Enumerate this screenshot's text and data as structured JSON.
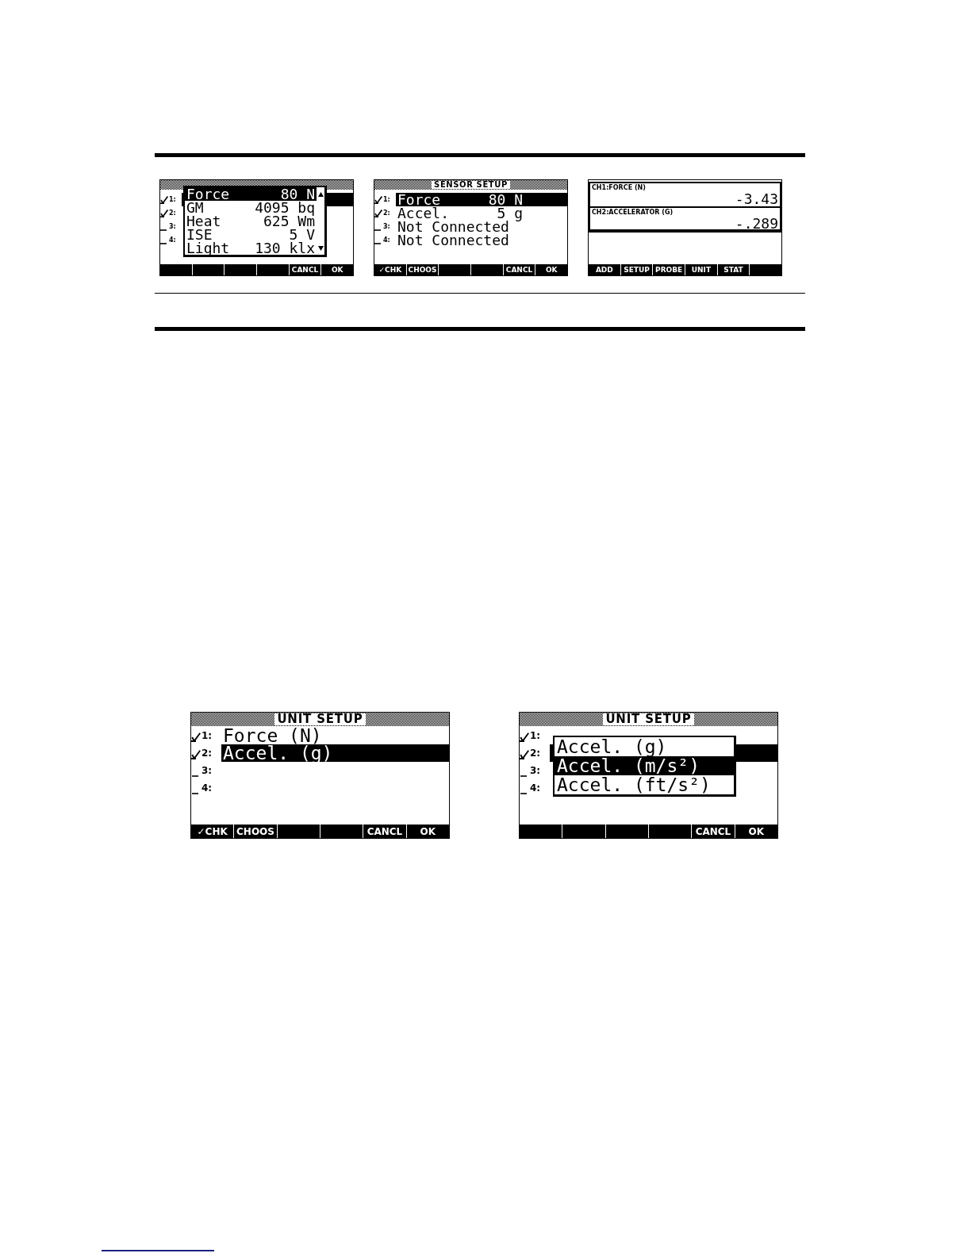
{
  "top_figure": {
    "screens": [
      {
        "kind": "setup",
        "rows": [
          {
            "checked": true,
            "number": "1:",
            "selected": true
          },
          {
            "checked": true,
            "number": "2:",
            "selected": false
          },
          {
            "checked": false,
            "number": "3:",
            "selected": false
          },
          {
            "checked": false,
            "number": "4:",
            "selected": false
          }
        ],
        "popup": {
          "scroll_indicators": true,
          "items": [
            {
              "name": "Force",
              "value": "80 N",
              "selected": true
            },
            {
              "name": "GM",
              "value": "4095 bq",
              "selected": false
            },
            {
              "name": "Heat",
              "value": "625 Wm",
              "selected": false
            },
            {
              "name": "ISE",
              "value": "5 V",
              "selected": false
            },
            {
              "name": "Light",
              "value": "130 klx",
              "selected": false
            }
          ]
        },
        "softkeys": [
          {
            "kind": "blank"
          },
          {
            "kind": "blank"
          },
          {
            "kind": "blank"
          },
          {
            "kind": "blank"
          },
          {
            "kind": "key",
            "label": "CANCL"
          },
          {
            "kind": "key",
            "label": "OK"
          }
        ]
      },
      {
        "kind": "setup",
        "title": "SENSOR SETUP",
        "rows": [
          {
            "checked": true,
            "number": "1:",
            "name": "Force",
            "value": "80 N",
            "selected": true
          },
          {
            "checked": true,
            "number": "2:",
            "name": "Accel.",
            "value": "5 g",
            "selected": false
          },
          {
            "checked": false,
            "number": "3:",
            "name": "Not Connected",
            "selected": false
          },
          {
            "checked": false,
            "number": "4:",
            "name": "Not Connected",
            "selected": false
          }
        ],
        "softkeys": [
          {
            "kind": "key",
            "label": "✓CHK"
          },
          {
            "kind": "key",
            "label": "CHOOS"
          },
          {
            "kind": "blank"
          },
          {
            "kind": "blank"
          },
          {
            "kind": "key",
            "label": "CANCL"
          },
          {
            "kind": "key",
            "label": "OK"
          }
        ]
      },
      {
        "kind": "channels",
        "channels": [
          {
            "label": "CH1:FORCE (N)",
            "reading": "-3.43"
          },
          {
            "label": "CH2:ACCELERATOR (G)",
            "reading": "-.289"
          }
        ],
        "softkeys": [
          {
            "kind": "key",
            "label": "ADD"
          },
          {
            "kind": "key",
            "label": "SETUP"
          },
          {
            "kind": "key",
            "label": "PROBE"
          },
          {
            "kind": "key",
            "label": "UNIT"
          },
          {
            "kind": "key",
            "label": "STAT"
          },
          {
            "kind": "blank"
          }
        ]
      }
    ]
  },
  "bottom_figure": {
    "screens": [
      {
        "kind": "setup",
        "title": "UNIT SETUP",
        "rows": [
          {
            "checked": true,
            "number": "1:",
            "name": "Force (N)",
            "selected": false
          },
          {
            "checked": true,
            "number": "2:",
            "name": "Accel. (g)",
            "selected": true
          },
          {
            "checked": false,
            "number": "3:",
            "selected": false
          },
          {
            "checked": false,
            "number": "4:",
            "selected": false
          }
        ],
        "softkeys": [
          {
            "kind": "key",
            "label": "✓CHK"
          },
          {
            "kind": "key",
            "label": "CHOOS"
          },
          {
            "kind": "blank"
          },
          {
            "kind": "blank"
          },
          {
            "kind": "key",
            "label": "CANCL"
          },
          {
            "kind": "key",
            "label": "OK"
          }
        ]
      },
      {
        "kind": "setup",
        "title": "UNIT SETUP",
        "rows": [
          {
            "checked": true,
            "number": "1:",
            "selected": false
          },
          {
            "checked": true,
            "number": "2:",
            "selected": true
          },
          {
            "checked": false,
            "number": "3:",
            "selected": false
          },
          {
            "checked": false,
            "number": "4:",
            "selected": false
          }
        ],
        "popup": {
          "items": [
            {
              "name": "Accel. (g)",
              "selected": false
            },
            {
              "name": "Accel. (m/s²)",
              "selected": true
            },
            {
              "name": "Accel. (ft/s²)",
              "selected": false
            }
          ]
        },
        "softkeys": [
          {
            "kind": "blank"
          },
          {
            "kind": "blank"
          },
          {
            "kind": "blank"
          },
          {
            "kind": "blank"
          },
          {
            "kind": "key",
            "label": "CANCL"
          },
          {
            "kind": "key",
            "label": "OK"
          }
        ]
      }
    ]
  }
}
